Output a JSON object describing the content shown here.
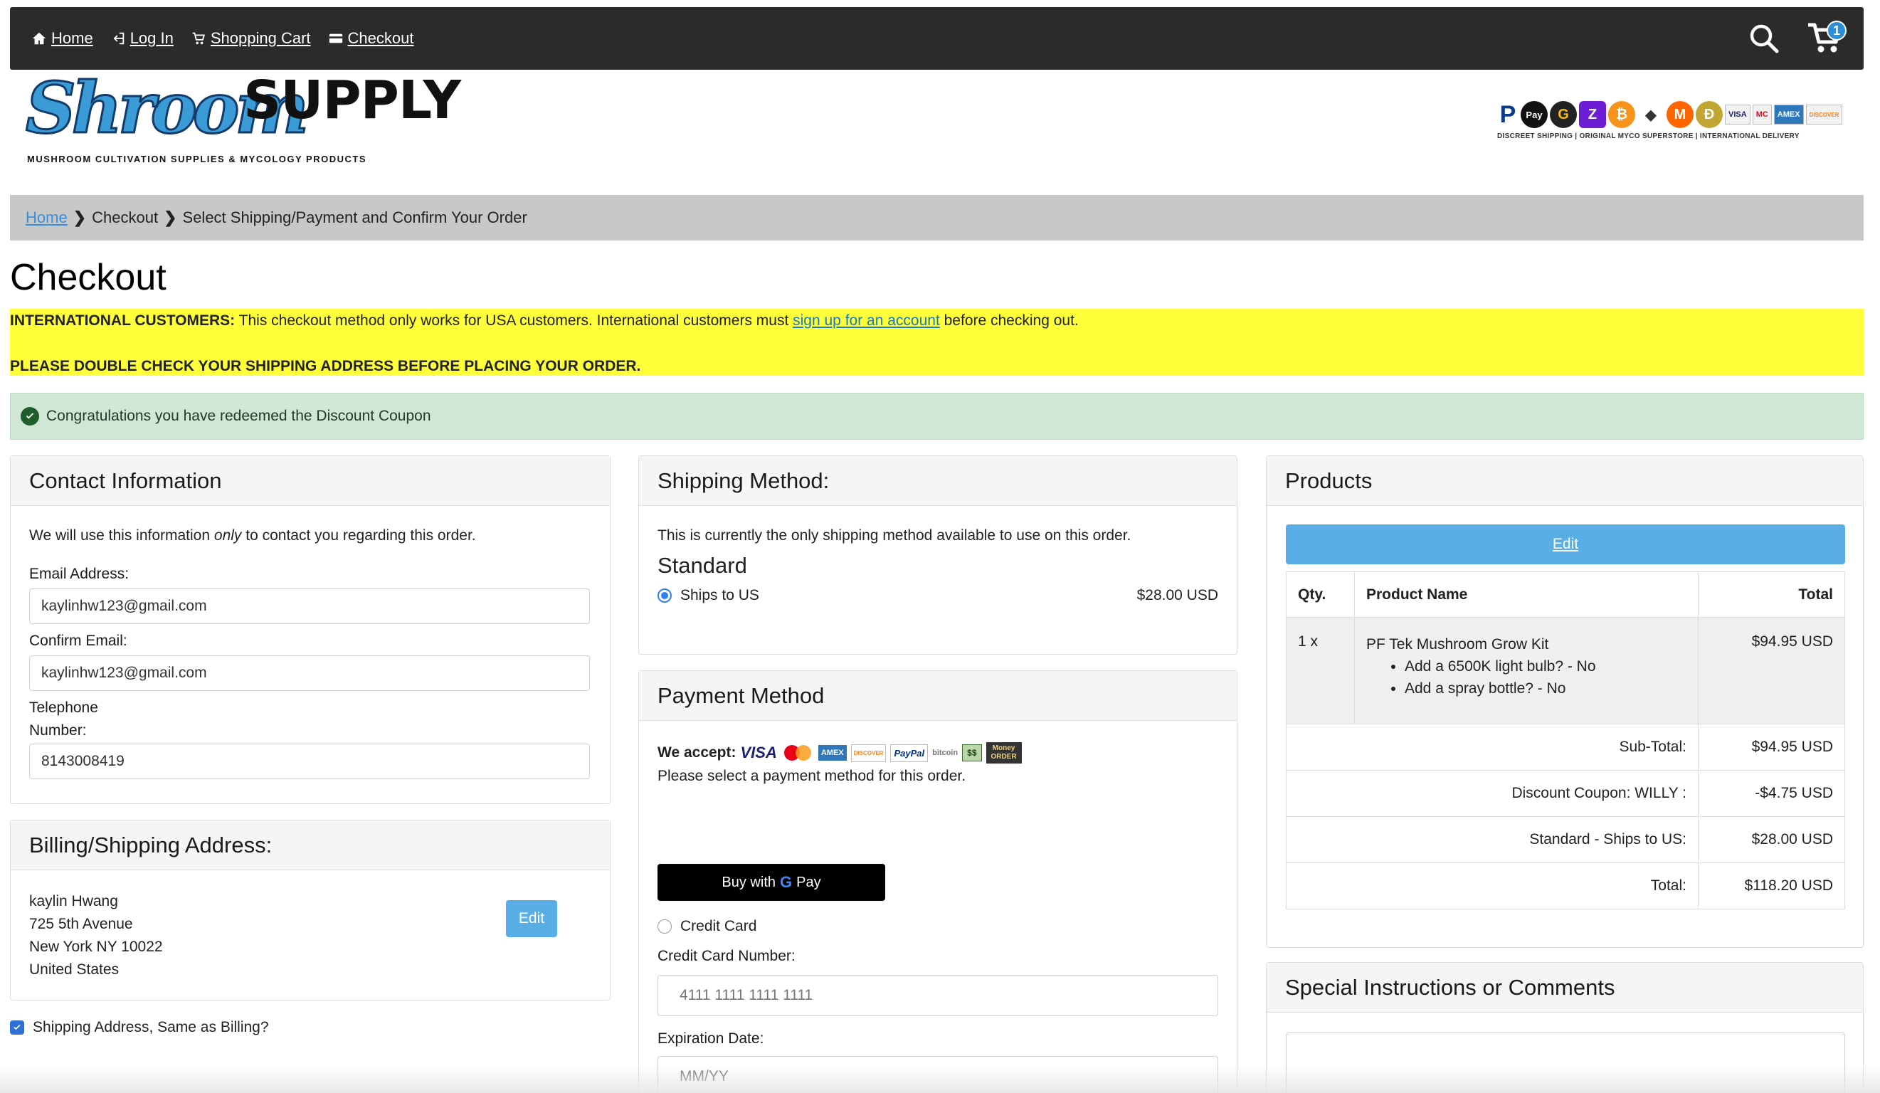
{
  "nav": {
    "home": "Home",
    "login": "Log In",
    "cart": "Shopping Cart",
    "checkout": "Checkout",
    "cart_count": "1"
  },
  "logo": {
    "script": "Shroom",
    "supply": "SUPPLY",
    "tagline": "MUSHROOM CULTIVATION SUPPLIES & MYCOLOGY PRODUCTS"
  },
  "pay_banner": {
    "tagline": "DISCREET SHIPPING | ORIGINAL MYCO SUPERSTORE | INTERNATIONAL DELIVERY",
    "icons": [
      "P",
      "Pay",
      "G",
      "Z",
      "₿",
      "◆",
      "M",
      "Ð"
    ],
    "cards": [
      "VISA",
      "MC",
      "AMEX",
      "DISCOVER"
    ]
  },
  "breadcrumb": {
    "home": "Home",
    "checkout": "Checkout",
    "current": "Select Shipping/Payment and Confirm Your Order"
  },
  "page_title": "Checkout",
  "notice": {
    "intl_label": "INTERNATIONAL CUSTOMERS:",
    "intl_text": "This checkout method only works for USA customers. International customers must",
    "signup_link": "sign up for an account",
    "intl_tail": "before checking out.",
    "double_check": "PLEASE DOUBLE CHECK YOUR SHIPPING ADDRESS BEFORE PLACING YOUR ORDER."
  },
  "success_message": "Congratulations you have redeemed the Discount Coupon",
  "contact": {
    "heading": "Contact Information",
    "intro_before": "We will use this information",
    "intro_em": "only",
    "intro_after": "to contact you regarding this order.",
    "email_label": "Email Address:",
    "email_value": "kaylinhw123@gmail.com",
    "confirm_label": "Confirm Email:",
    "confirm_value": "kaylinhw123@gmail.com",
    "phone_label_1": "Telephone",
    "phone_label_2": "Number:",
    "phone_value": "8143008419"
  },
  "billing": {
    "heading": "Billing/Shipping Address:",
    "name": "kaylin Hwang",
    "street": "725 5th Avenue",
    "city": "New York NY 10022",
    "country": "United States",
    "edit_label": "Edit",
    "same_label": "Shipping Address, Same as Billing?",
    "same_checked": true
  },
  "shipping": {
    "heading": "Shipping Method:",
    "intro": "This is currently the only shipping method available to use on this order.",
    "method_name": "Standard",
    "option_label": "Ships to US",
    "option_price": "$28.00 USD"
  },
  "payment": {
    "heading": "Payment Method",
    "we_accept": "We accept:",
    "accept_logos": [
      "VISA",
      "MC",
      "AMEX",
      "DISCOVER",
      "PayPal",
      "bitcoin",
      "$$",
      "Money ORDER"
    ],
    "instruction": "Please select a payment method for this order.",
    "gpay_label": "Buy with",
    "gpay_brand": "Pay",
    "credit_label": "Credit Card",
    "cc_number_label": "Credit Card Number:",
    "cc_number_placeholder": "4111 1111 1111 1111",
    "exp_label": "Expiration Date:",
    "exp_placeholder": "MM/YY"
  },
  "products": {
    "heading": "Products",
    "edit_label": "Edit",
    "col_qty": "Qty.",
    "col_name": "Product Name",
    "col_total": "Total",
    "items": [
      {
        "qty": "1 x",
        "name": "PF Tek Mushroom Grow Kit",
        "options": [
          "Add a 6500K light bulb? - No",
          "Add a spray bottle? - No"
        ],
        "total": "$94.95 USD"
      }
    ],
    "summary": [
      {
        "label": "Sub-Total:",
        "value": "$94.95 USD"
      },
      {
        "label": "Discount Coupon: WILLY :",
        "value": "-$4.75 USD"
      },
      {
        "label": "Standard - Ships to US:",
        "value": "$28.00 USD"
      },
      {
        "label": "Total:",
        "value": "$118.20 USD"
      }
    ]
  },
  "comments": {
    "heading": "Special Instructions or Comments"
  },
  "colors": {
    "topbar": "#2b2b2b",
    "notice": "#ffff3a",
    "success": "#d1e7d6",
    "accent_blue": "#5aaee6"
  }
}
